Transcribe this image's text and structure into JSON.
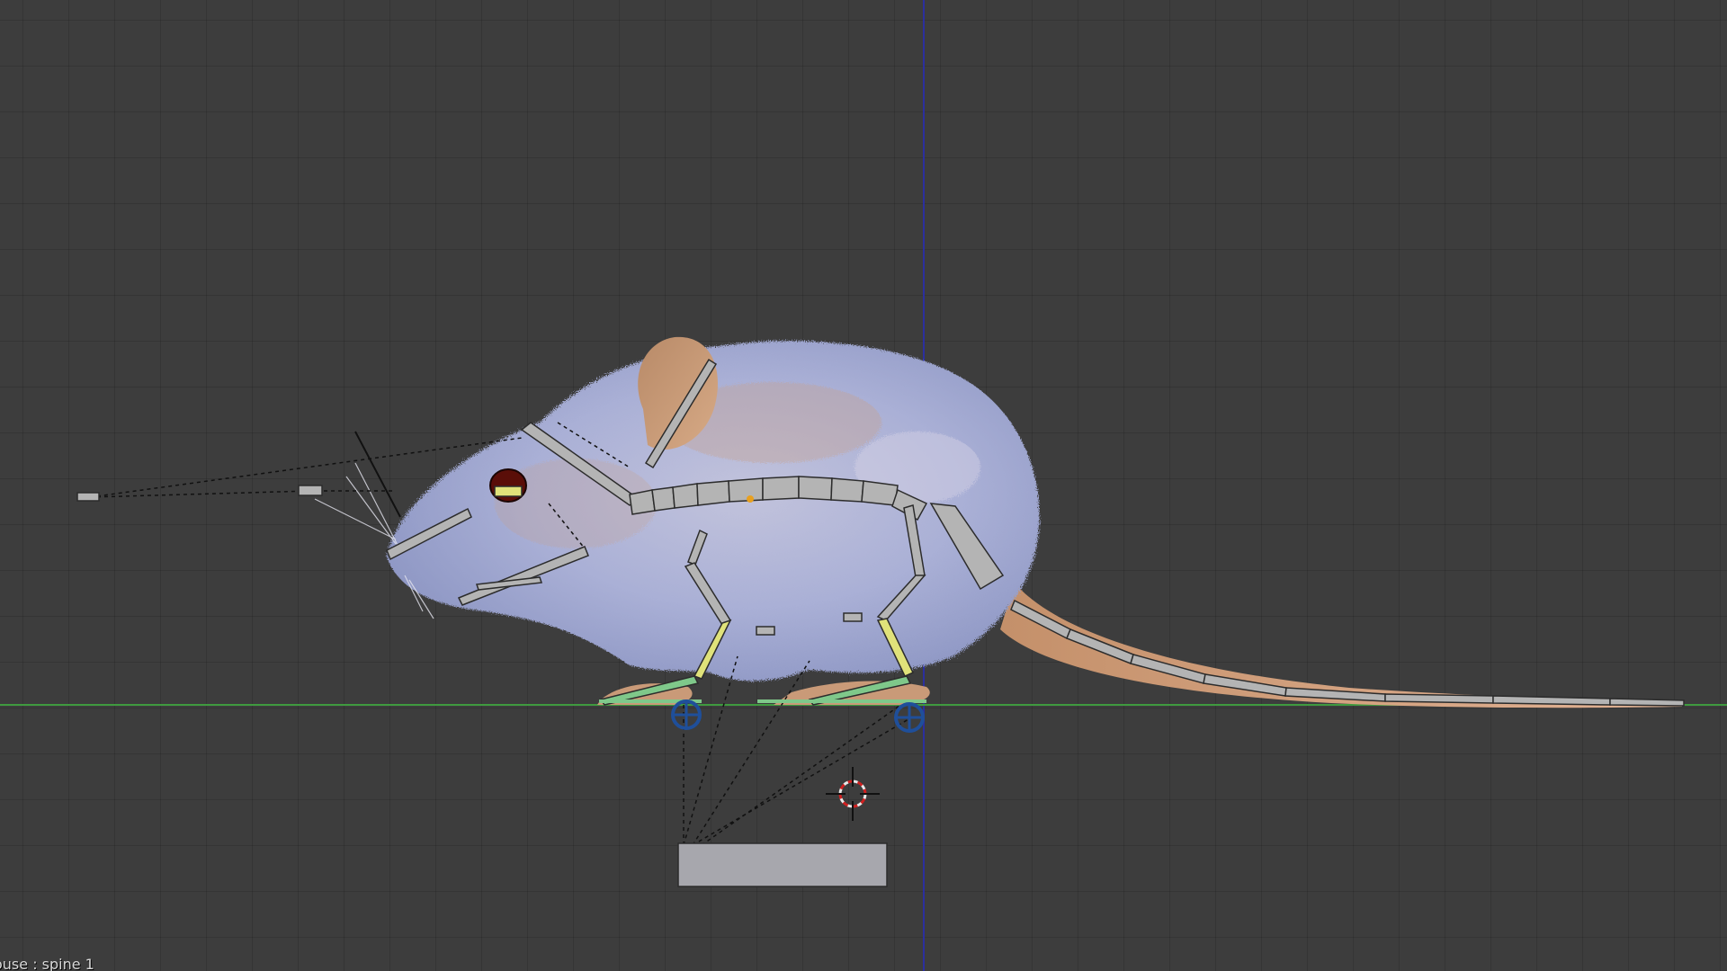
{
  "viewport": {
    "active_object_label": "ouse : spine 1",
    "axis_colors": {
      "x_axis": "#3f9a3f",
      "z_axis": "#2b2f9e"
    },
    "background_color": "#3d3d3d",
    "grid_color": "#363636"
  },
  "model": {
    "name": "mouse",
    "fur_color": "#a9b2d8",
    "skin_color": "#c99a78",
    "bone_color": "#b4b4b4",
    "selected_bone_color": "#e0e27a",
    "ik_bone_color": "#7fc88a",
    "eye_color": "#5a0e08"
  },
  "icons": {
    "cursor": "3d-cursor-icon",
    "ik_target": "ik-target-icon"
  }
}
